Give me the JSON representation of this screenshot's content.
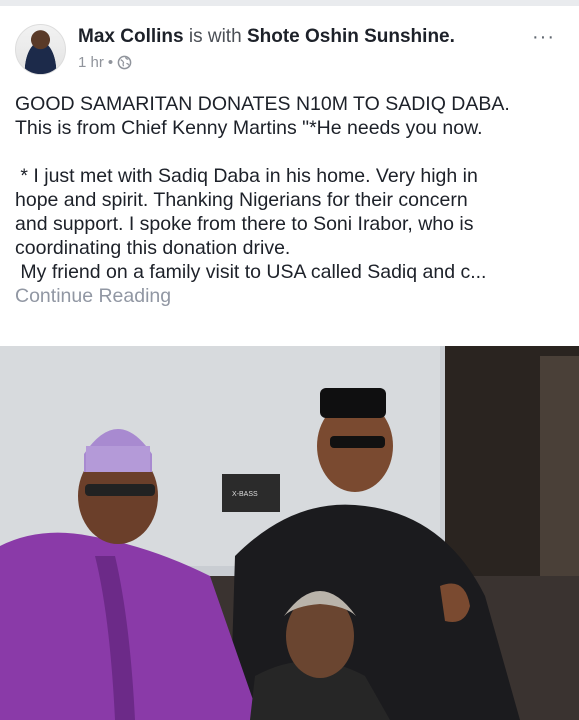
{
  "post": {
    "author": "Max Collins",
    "with_text": "is with",
    "tagged": "Shote Oshin Sunshine.",
    "time": "1 hr",
    "separator": "•",
    "more": "···",
    "lines": [
      "GOOD SAMARITAN DONATES N10M TO SADIQ DABA.",
      "This is from Chief Kenny Martins \"*He needs you now.",
      "",
      " * I just met with Sadiq Daba in his home. Very high in",
      "hope and spirit. Thanking Nigerians for their concern",
      "and support. I spoke from there to Soni Irabor, who is",
      "coordinating this donation drive.",
      " My friend on a family visit to USA called Sadiq and c..."
    ],
    "continue_label": "Continue Reading"
  },
  "photo": {
    "badge_text": "X-BASS"
  },
  "colors": {
    "name": "#1d2129",
    "meta": "#90949c",
    "link": "#9197a3",
    "purple_agbada": "#8a3aa8"
  }
}
